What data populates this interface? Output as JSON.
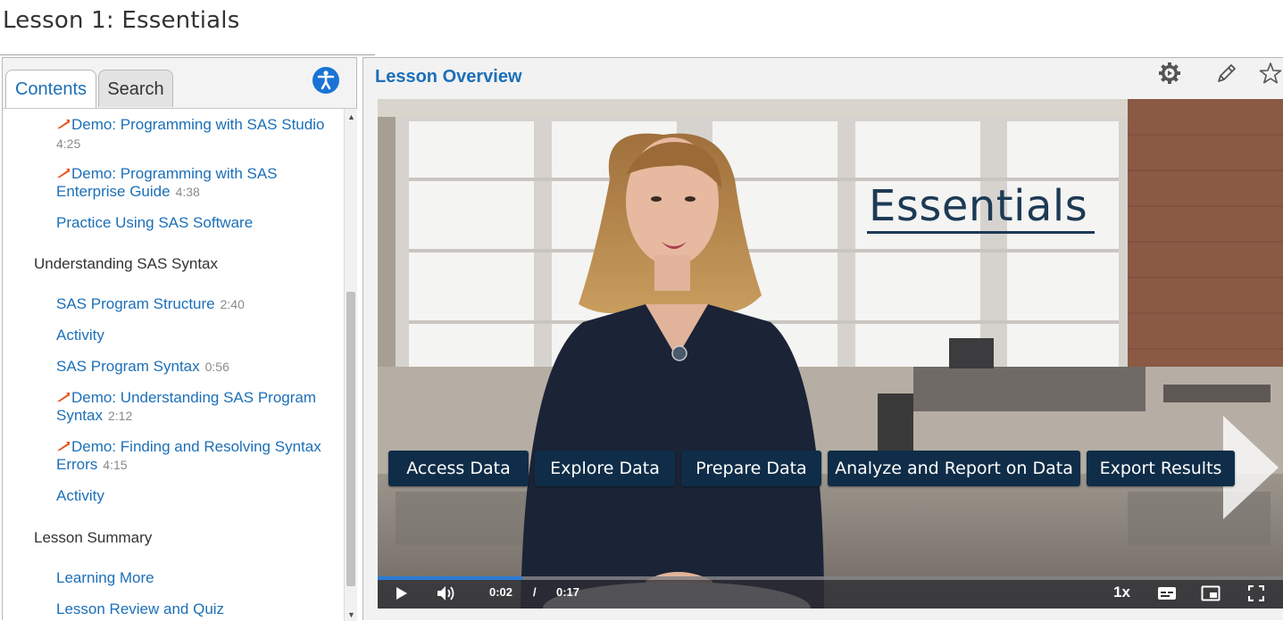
{
  "page": {
    "title": "Lesson 1: Essentials"
  },
  "sidebar": {
    "tabs": [
      {
        "label": "Contents",
        "active": true
      },
      {
        "label": "Search",
        "active": false
      }
    ],
    "accessibility_icon": "accessibility-icon",
    "items": [
      {
        "type": "demo",
        "label": "Demo: Programming with SAS Studio",
        "duration": "4:25"
      },
      {
        "type": "demo",
        "label_line1": "Demo: Programming with SAS",
        "label_line2": "Enterprise Guide",
        "duration": "4:38"
      },
      {
        "type": "link",
        "label": "Practice Using SAS Software"
      },
      {
        "type": "section",
        "label": "Understanding SAS Syntax"
      },
      {
        "type": "link",
        "label": "SAS Program Structure",
        "duration": "2:40"
      },
      {
        "type": "link",
        "label": "Activity"
      },
      {
        "type": "link",
        "label": "SAS Program Syntax",
        "duration": "0:56"
      },
      {
        "type": "demo",
        "label_line1": "Demo: Understanding SAS Program",
        "label_line2": "Syntax",
        "duration": "2:12"
      },
      {
        "type": "demo",
        "label_line1": "Demo: Finding and Resolving Syntax",
        "label_line2": "Errors",
        "duration": "4:15"
      },
      {
        "type": "link",
        "label": "Activity"
      },
      {
        "type": "section",
        "label": "Lesson Summary"
      },
      {
        "type": "link",
        "label": "Learning More"
      },
      {
        "type": "link",
        "label": "Lesson Review and Quiz"
      }
    ],
    "scroll_position": 0.45
  },
  "main": {
    "title": "Lesson Overview",
    "toolbar_icons": [
      "settings-icon",
      "pencil-icon",
      "star-icon"
    ]
  },
  "video": {
    "slide_title": "Essentials",
    "steps": [
      "Access Data",
      "Explore Data",
      "Prepare Data",
      "Analyze and Report on Data",
      "Export Results"
    ],
    "current_time": "0:02",
    "separator": "/",
    "total_time": "0:17",
    "progress": 0.16,
    "speed": "1x",
    "control_icons": [
      "play-icon",
      "volume-icon",
      "captions-icon",
      "picture-in-picture-icon",
      "fullscreen-icon"
    ]
  },
  "colors": {
    "link": "#1c6fb8",
    "demo_icon": "#e8541c",
    "step_bg": "#0f2d48",
    "progress": "#2b7bd6"
  }
}
